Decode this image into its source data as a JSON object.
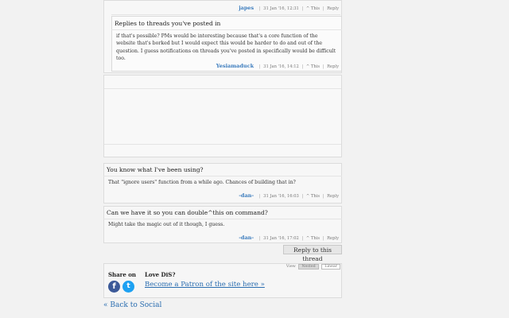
{
  "thread": {
    "top_post": {
      "author": "japes",
      "date": "31 Jan '16, 12:31",
      "upvote": "^ This",
      "reply": "Reply"
    },
    "reply_posts": [
      {
        "subject": "Replies to threads you've posted in",
        "body": "if that's possible? PMs would be interesting because that's a core function of the website that's borked but I would expect this would be harder to do and out of the question. I guess notifications on threads you've posted in specifically would be difficult too.",
        "author": "Yesiamaduck",
        "date": "31 Jan '16, 14:12",
        "upvote": "^ This",
        "reply": "Reply"
      }
    ],
    "posts": [
      {
        "subject": "You know what I've been using?",
        "body": "That \"ignore users\" function from a while ago. Chances of building that in?",
        "author": "-dan-",
        "date": "31 Jan '16, 16:03",
        "upvote": "^ This",
        "reply": "Reply"
      },
      {
        "subject": "Can we have it so you can double^this on command?",
        "body": "Might take the magic out of it though, I guess.",
        "author": "-dan-",
        "date": "31 Jan '16, 17:02",
        "upvote": "^ This",
        "reply": "Reply"
      }
    ],
    "reply_to_thread": "Reply to this thread"
  },
  "view": {
    "label": "View",
    "nested": "Nested",
    "linear": "Linear"
  },
  "footer": {
    "share_label": "Share on",
    "love_label": "Love DiS?",
    "patron_link": "Become a Patron of the site here »",
    "back_link": "« Back to Social",
    "facebook_glyph": "f",
    "twitter_glyph": "t"
  },
  "colors": {
    "author_blue": "#3a7bbd",
    "link_blue": "#2a6db0",
    "facebook": "#3b5998",
    "twitter": "#1da1f2"
  },
  "icons": {
    "facebook": "facebook-icon",
    "twitter": "twitter-icon"
  }
}
